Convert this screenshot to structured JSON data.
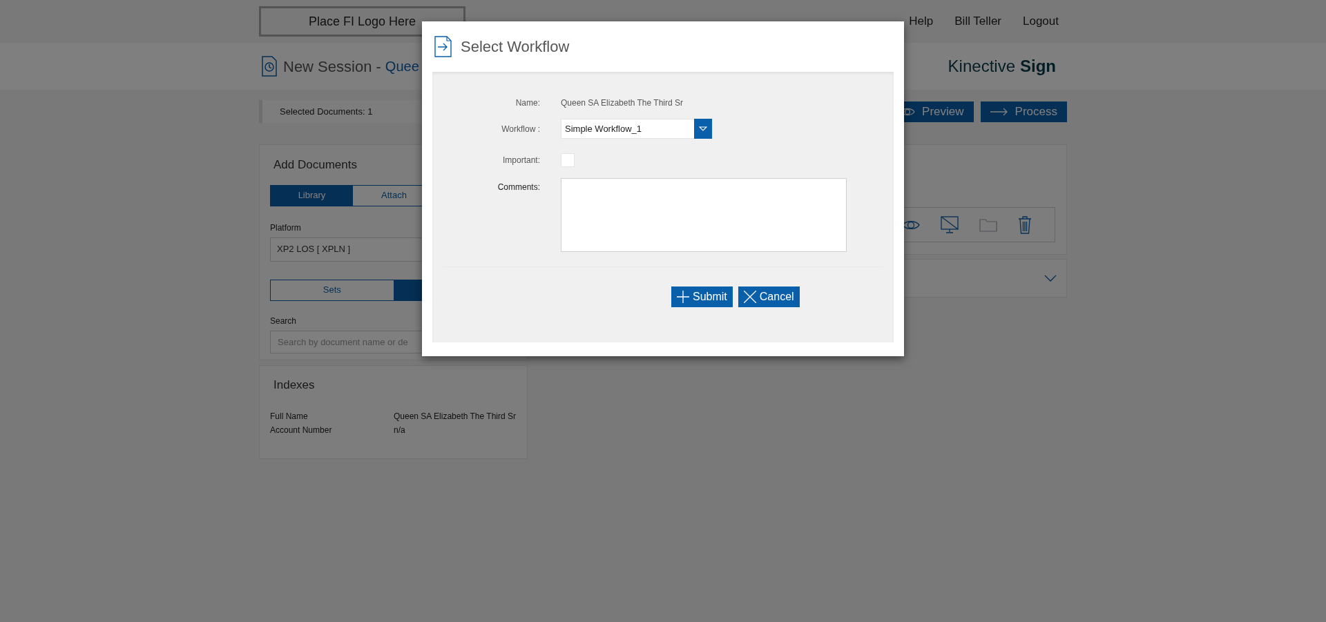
{
  "header": {
    "logo": "Place FI Logo Here",
    "nav": [
      {
        "label": "Help"
      },
      {
        "label": "Bill Teller"
      },
      {
        "label": "Logout"
      }
    ]
  },
  "session": {
    "title": "New Session -",
    "customer": "Quee",
    "brand_light": "Kinective",
    "brand_bold": "Sign"
  },
  "selected_documents": "Selected Documents: 1",
  "actions": [
    {
      "label": "Preview",
      "kind": "preview"
    },
    {
      "label": "Process",
      "kind": "process"
    }
  ],
  "add_documents": {
    "title": "Add Documents",
    "tabs": [
      {
        "label": "Library",
        "selected": true
      },
      {
        "label": "Attach",
        "selected": false
      }
    ],
    "platform_label": "Platform",
    "platform_value": "XP2 LOS [ XPLN ]",
    "toggle": [
      {
        "label": "Sets",
        "selected": false
      },
      {
        "selected": true
      }
    ],
    "search_label": "Search",
    "search_placeholder": "Search by document name or de"
  },
  "indexes": {
    "title": "Indexes",
    "rows": [
      {
        "label": "Full Name",
        "value": "Queen SA Elizabeth The Third Sr"
      },
      {
        "label": "Account Number",
        "value": "n/a"
      }
    ]
  },
  "modal": {
    "title": "Select Workflow",
    "name_label": "Name:",
    "name_value": "Queen SA Elizabeth The Third Sr",
    "workflow_label": "Workflow :",
    "workflow_value": "Simple Workflow_1",
    "important_label": "Important:",
    "important_checked": false,
    "comments_label": "Comments:",
    "buttons": [
      {
        "label": "Submit",
        "kind": "submit"
      },
      {
        "label": "Cancel",
        "kind": "cancel"
      }
    ]
  }
}
